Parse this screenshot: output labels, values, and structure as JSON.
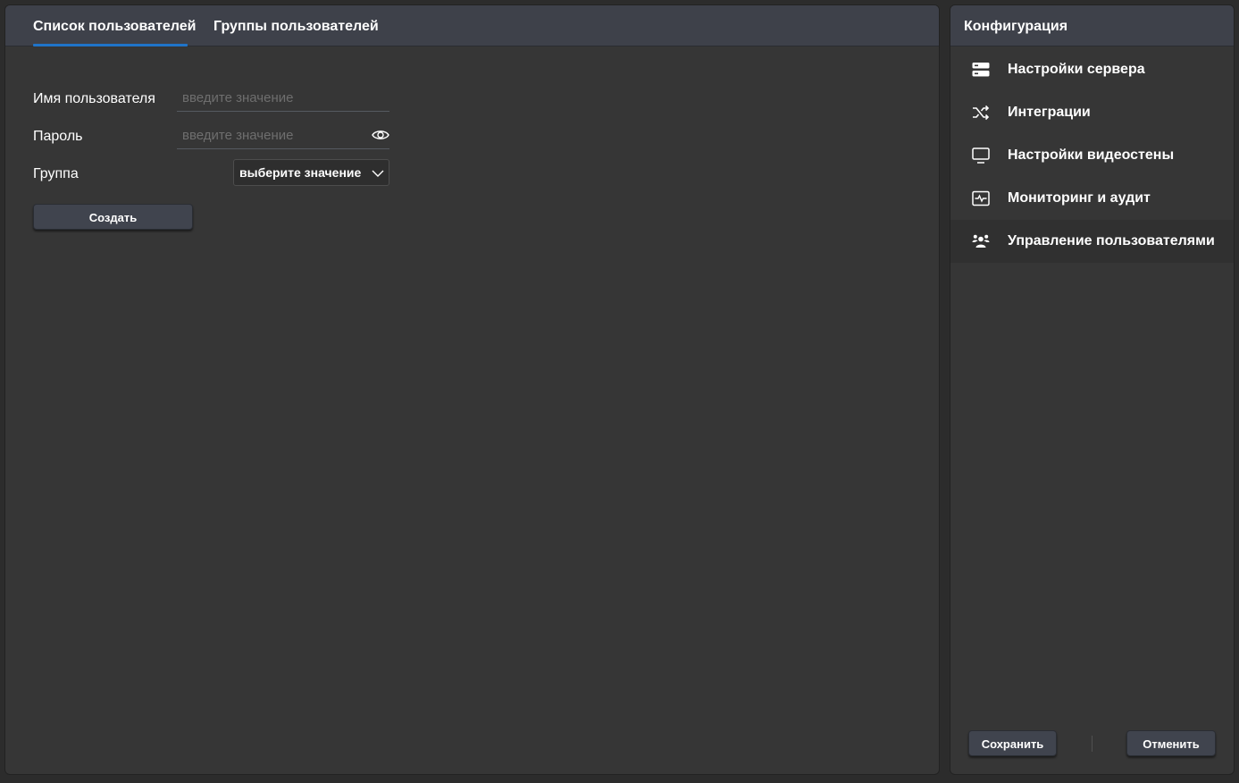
{
  "main": {
    "tabs": [
      {
        "label": "Список пользователей",
        "active": true
      },
      {
        "label": "Группы пользователей",
        "active": false
      }
    ],
    "form": {
      "username": {
        "label": "Имя пользователя",
        "value": "",
        "placeholder": "введите значение"
      },
      "password": {
        "label": "Пароль",
        "value": "",
        "placeholder": "введите значение",
        "icon": "eye-icon"
      },
      "group": {
        "label": "Группа",
        "selected": "выберите значение",
        "icon": "chevron-down-icon"
      },
      "create_label": "Создать"
    }
  },
  "sidebar": {
    "title": "Конфигурация",
    "items": [
      {
        "label": "Настройки сервера",
        "icon": "server-icon",
        "active": false
      },
      {
        "label": "Интеграции",
        "icon": "shuffle-icon",
        "active": false
      },
      {
        "label": "Настройки видеостены",
        "icon": "monitor-icon",
        "active": false
      },
      {
        "label": "Мониторинг и аудит",
        "icon": "activity-monitor-icon",
        "active": false
      },
      {
        "label": "Управление пользователями",
        "icon": "users-icon",
        "active": true
      }
    ],
    "save_label": "Сохранить",
    "cancel_label": "Отменить"
  },
  "colors": {
    "accent": "#1f74c9",
    "panel_bg": "#363636",
    "header_bg": "#3e414a",
    "button_bg": "#40444e"
  }
}
